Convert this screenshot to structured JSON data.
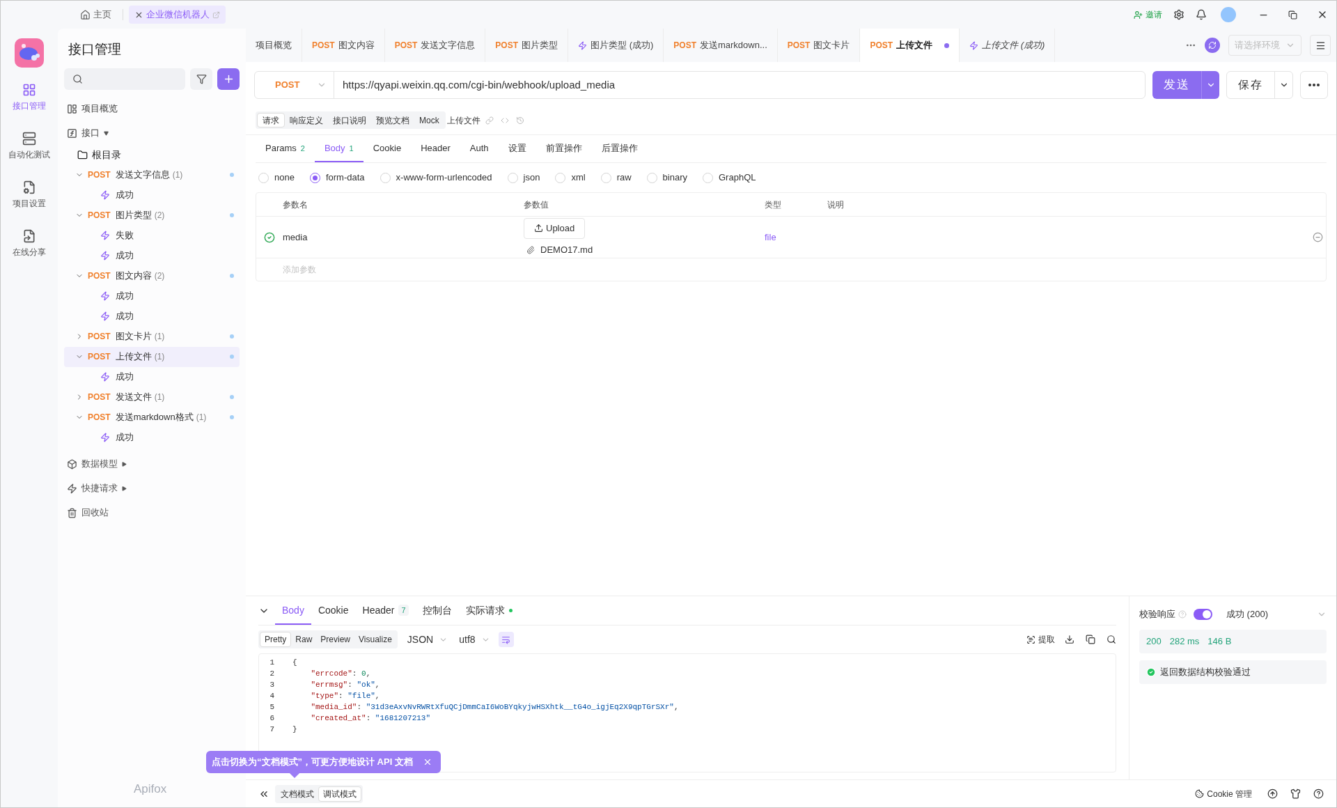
{
  "top_bar": {
    "home": "主页",
    "project_tab": "企业微信机器人",
    "invite": "邀请"
  },
  "rail": [
    {
      "label": "接口管理",
      "kind": "api",
      "selected": true
    },
    {
      "label": "自动化测试",
      "kind": "test",
      "selected": false
    },
    {
      "label": "项目设置",
      "kind": "settings",
      "selected": false
    },
    {
      "label": "在线分享",
      "kind": "share",
      "selected": false
    }
  ],
  "sidebar": {
    "title": "接口管理",
    "overview": "项目概览",
    "api_section": "接口",
    "root": "根目录",
    "tree": [
      {
        "method": "POST",
        "name": "发送文字信息",
        "count": "(1)",
        "expanded": true,
        "selected": false,
        "children": [
          {
            "name": "成功"
          }
        ]
      },
      {
        "method": "POST",
        "name": "图片类型",
        "count": "(2)",
        "expanded": true,
        "selected": false,
        "children": [
          {
            "name": "失败"
          },
          {
            "name": "成功"
          }
        ]
      },
      {
        "method": "POST",
        "name": "图文内容",
        "count": "(2)",
        "expanded": true,
        "selected": false,
        "children": [
          {
            "name": "成功"
          },
          {
            "name": "成功"
          }
        ]
      },
      {
        "method": "POST",
        "name": "图文卡片",
        "count": "(1)",
        "expanded": false,
        "selected": false
      },
      {
        "method": "POST",
        "name": "上传文件",
        "count": "(1)",
        "expanded": true,
        "selected": true,
        "children": [
          {
            "name": "成功"
          }
        ]
      },
      {
        "method": "POST",
        "name": "发送文件",
        "count": "(1)",
        "expanded": false,
        "selected": false
      },
      {
        "method": "POST",
        "name": "发送markdown格式",
        "count": "(1)",
        "expanded": true,
        "selected": false,
        "children": [
          {
            "name": "成功"
          }
        ]
      }
    ],
    "footer_items": [
      {
        "label": "数据模型",
        "kind": "model"
      },
      {
        "label": "快捷请求",
        "kind": "quick"
      },
      {
        "label": "回收站",
        "kind": "trash"
      }
    ],
    "brand": "Apifox"
  },
  "tabs": [
    {
      "label": "项目概览",
      "kind": "page",
      "selected": false,
      "preview": false,
      "unsaved": false
    },
    {
      "method": "POST",
      "label": "图文内容",
      "kind": "api",
      "selected": false,
      "preview": false,
      "unsaved": false
    },
    {
      "method": "POST",
      "label": "发送文字信息",
      "kind": "api",
      "selected": false,
      "preview": false,
      "unsaved": false
    },
    {
      "method": "POST",
      "label": "图片类型",
      "kind": "api",
      "selected": false,
      "preview": false,
      "unsaved": false
    },
    {
      "label": "图片类型 (成功)",
      "kind": "case",
      "selected": false,
      "preview": false,
      "unsaved": false
    },
    {
      "method": "POST",
      "label": "发送markdown...",
      "kind": "api",
      "selected": false,
      "preview": false,
      "unsaved": false
    },
    {
      "method": "POST",
      "label": "图文卡片",
      "kind": "api",
      "selected": false,
      "preview": false,
      "unsaved": false
    },
    {
      "method": "POST",
      "label": "上传文件",
      "kind": "api",
      "selected": true,
      "preview": false,
      "unsaved": true
    },
    {
      "label": "上传文件 (成功)",
      "kind": "case",
      "selected": false,
      "preview": true,
      "unsaved": false
    }
  ],
  "env_select": {
    "placeholder": "请选择环境"
  },
  "request": {
    "method": "POST",
    "url": "https://qyapi.weixin.qq.com/cgi-bin/webhook/upload_media",
    "send": "发送",
    "save": "保存"
  },
  "doc_tabs": [
    {
      "label": "请求",
      "selected": true
    },
    {
      "label": "响应定义",
      "selected": false
    },
    {
      "label": "接口说明",
      "selected": false
    },
    {
      "label": "预览文档",
      "selected": false
    },
    {
      "label": "Mock",
      "selected": false
    }
  ],
  "doc_title": "上传文件",
  "param_tabs": [
    {
      "label": "Params",
      "count": "2",
      "selected": false
    },
    {
      "label": "Body",
      "count": "1",
      "selected": true
    },
    {
      "label": "Cookie",
      "selected": false
    },
    {
      "label": "Header",
      "selected": false
    },
    {
      "label": "Auth",
      "selected": false
    },
    {
      "label": "设置",
      "selected": false
    },
    {
      "label": "前置操作",
      "selected": false
    },
    {
      "label": "后置操作",
      "selected": false
    }
  ],
  "body_types": [
    {
      "label": "none",
      "selected": false
    },
    {
      "label": "form-data",
      "selected": true
    },
    {
      "label": "x-www-form-urlencoded",
      "selected": false
    },
    {
      "label": "json",
      "selected": false
    },
    {
      "label": "xml",
      "selected": false
    },
    {
      "label": "raw",
      "selected": false
    },
    {
      "label": "binary",
      "selected": false
    },
    {
      "label": "GraphQL",
      "selected": false
    }
  ],
  "params_table": {
    "columns": [
      "参数名",
      "参数值",
      "类型",
      "说明"
    ],
    "rows": [
      {
        "enabled": true,
        "name": "media",
        "upload": "Upload",
        "file": "DEMO17.md",
        "type": "file"
      }
    ],
    "add_placeholder": "添加参数"
  },
  "response": {
    "tabs": [
      {
        "label": "Body",
        "selected": true,
        "dot": false
      },
      {
        "label": "Cookie",
        "selected": false,
        "dot": false
      },
      {
        "label": "Header",
        "count": "7",
        "selected": false,
        "dot": false
      },
      {
        "label": "控制台",
        "selected": false,
        "dot": false
      },
      {
        "label": "实际请求",
        "selected": false,
        "dot": true
      }
    ],
    "views": [
      {
        "label": "Pretty",
        "selected": true
      },
      {
        "label": "Raw",
        "selected": false
      },
      {
        "label": "Preview",
        "selected": false
      },
      {
        "label": "Visualize",
        "selected": false
      }
    ],
    "format": "JSON",
    "encoding": "utf8",
    "extract": "提取",
    "lines": [
      {
        "no": "1",
        "text": "{"
      },
      {
        "no": "2",
        "text": "    \"errcode\": 0,"
      },
      {
        "no": "3",
        "text": "    \"errmsg\": \"ok\","
      },
      {
        "no": "4",
        "text": "    \"type\": \"file\","
      },
      {
        "no": "5",
        "text": "    \"media_id\": \"31d3eAxvNvRWRtXfuQCjDmmCaI6WoBYqkyjwHSXhtk__tG4o_igjEq2X9qpTGrSXr\","
      },
      {
        "no": "6",
        "text": "    \"created_at\": \"1681207213\""
      },
      {
        "no": "7",
        "text": "}"
      }
    ]
  },
  "validation": {
    "label": "校验响应",
    "on": true,
    "status": "成功 (200)",
    "code": "200",
    "time": "282 ms",
    "size": "146 B",
    "result": "返回数据结构校验通过"
  },
  "tip": {
    "text": "点击切换为“文档模式”，可更方便地设计 API 文档"
  },
  "bottom_bar": {
    "modes": [
      {
        "label": "文档模式",
        "selected": false
      },
      {
        "label": "调试模式",
        "selected": true
      }
    ],
    "cookie": "Cookie 管理"
  }
}
